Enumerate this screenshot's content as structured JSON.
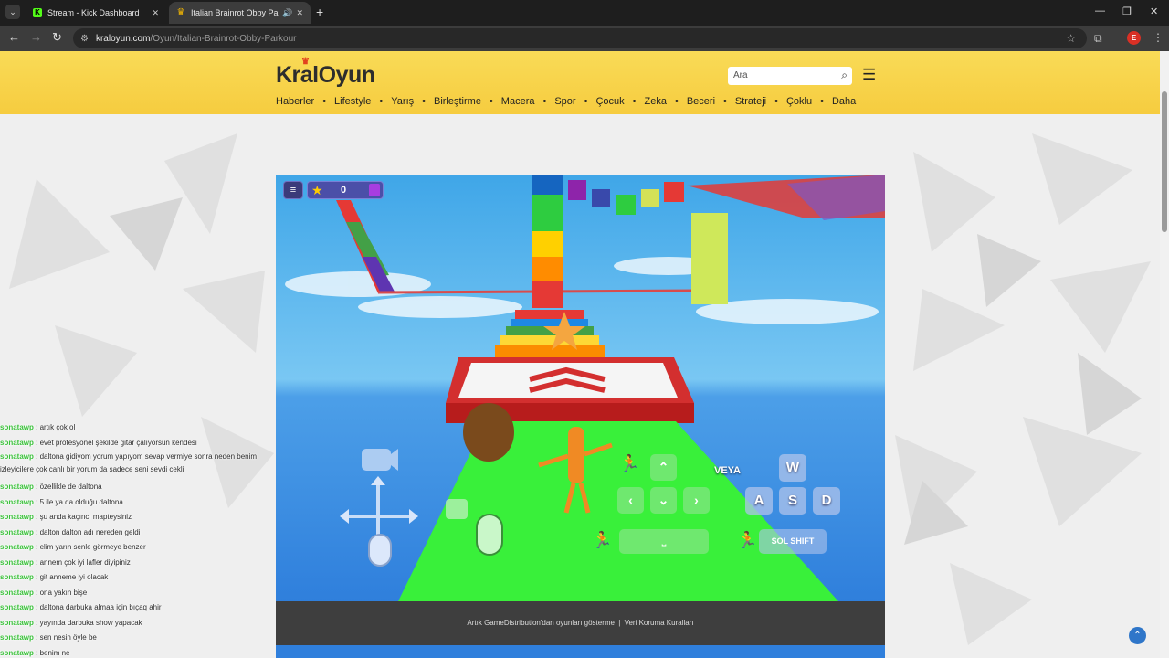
{
  "browser": {
    "tabs": [
      {
        "title": "Stream - Kick Dashboard",
        "favicon": "kick-icon"
      },
      {
        "title": "Italian Brainrot Obby Parkour",
        "favicon": "crown-icon",
        "audio": true
      }
    ],
    "url_host": "kraloyun.com",
    "url_path": "/Oyun/Italian-Brainrot-Obby-Parkour",
    "profile_initial": "E"
  },
  "site": {
    "logo": "KralOyun",
    "search_placeholder": "Ara",
    "nav": [
      "Haberler",
      "Lifestyle",
      "Yarış",
      "Birleştirme",
      "Macera",
      "Spor",
      "Çocuk",
      "Zeka",
      "Beceri",
      "Strateji",
      "Çoklu",
      "Daha"
    ]
  },
  "game": {
    "star_count": "0",
    "or_label": "VEYA",
    "keys": {
      "w": "W",
      "a": "A",
      "s": "S",
      "d": "D",
      "shift": "SOL SHIFT"
    }
  },
  "footer": {
    "gd_text": "Artık GameDistribution'dan oyunları gösterme",
    "separator": "|",
    "privacy": "Veri Koruma Kuralları"
  },
  "chat": [
    {
      "user": "sonatawp",
      "text": ": artık çok ol"
    },
    {
      "user": "sonatawp",
      "text": ": evet profesyonel şekilde gitar çalıyorsun kendesi"
    },
    {
      "user": "sonatawp",
      "text": ": daltona gidiyom yorum yapıyom sevap vermiye sonra neden benim izleyicilere çok canlı bir yorum da sadece seni sevdi cekli"
    },
    {
      "user": "sonatawp",
      "text": ": özellikle de daltona"
    },
    {
      "user": "sonatawp",
      "text": ": 5 ile ya da olduğu daltona"
    },
    {
      "user": "sonatawp",
      "text": ": şu anda kaçıncı mapteysiniz"
    },
    {
      "user": "sonatawp",
      "text": ": dalton dalton adı nereden geldi"
    },
    {
      "user": "sonatawp",
      "text": ": elim yarın senle görmeye benzer"
    },
    {
      "user": "sonatawp",
      "text": ": annem çok iyi lafler diyipiniz"
    },
    {
      "user": "sonatawp",
      "text": ": git anneme iyi olacak"
    },
    {
      "user": "sonatawp",
      "text": ": ona yakın bişe"
    },
    {
      "user": "sonatawp",
      "text": ": daltona darbuka almaa için bıçaq ahir"
    },
    {
      "user": "sonatawp",
      "text": ": yayında darbuka show yapacak"
    },
    {
      "user": "sonatawp",
      "text": ": sen nesin öyle be"
    },
    {
      "user": "sonatawp",
      "text": ": benim ne"
    }
  ],
  "colors": {
    "header_yellow": "#f8d54c",
    "chat_user": "#3bc23b",
    "sky": "#5ab4ee",
    "green_path": "#39f03a"
  }
}
